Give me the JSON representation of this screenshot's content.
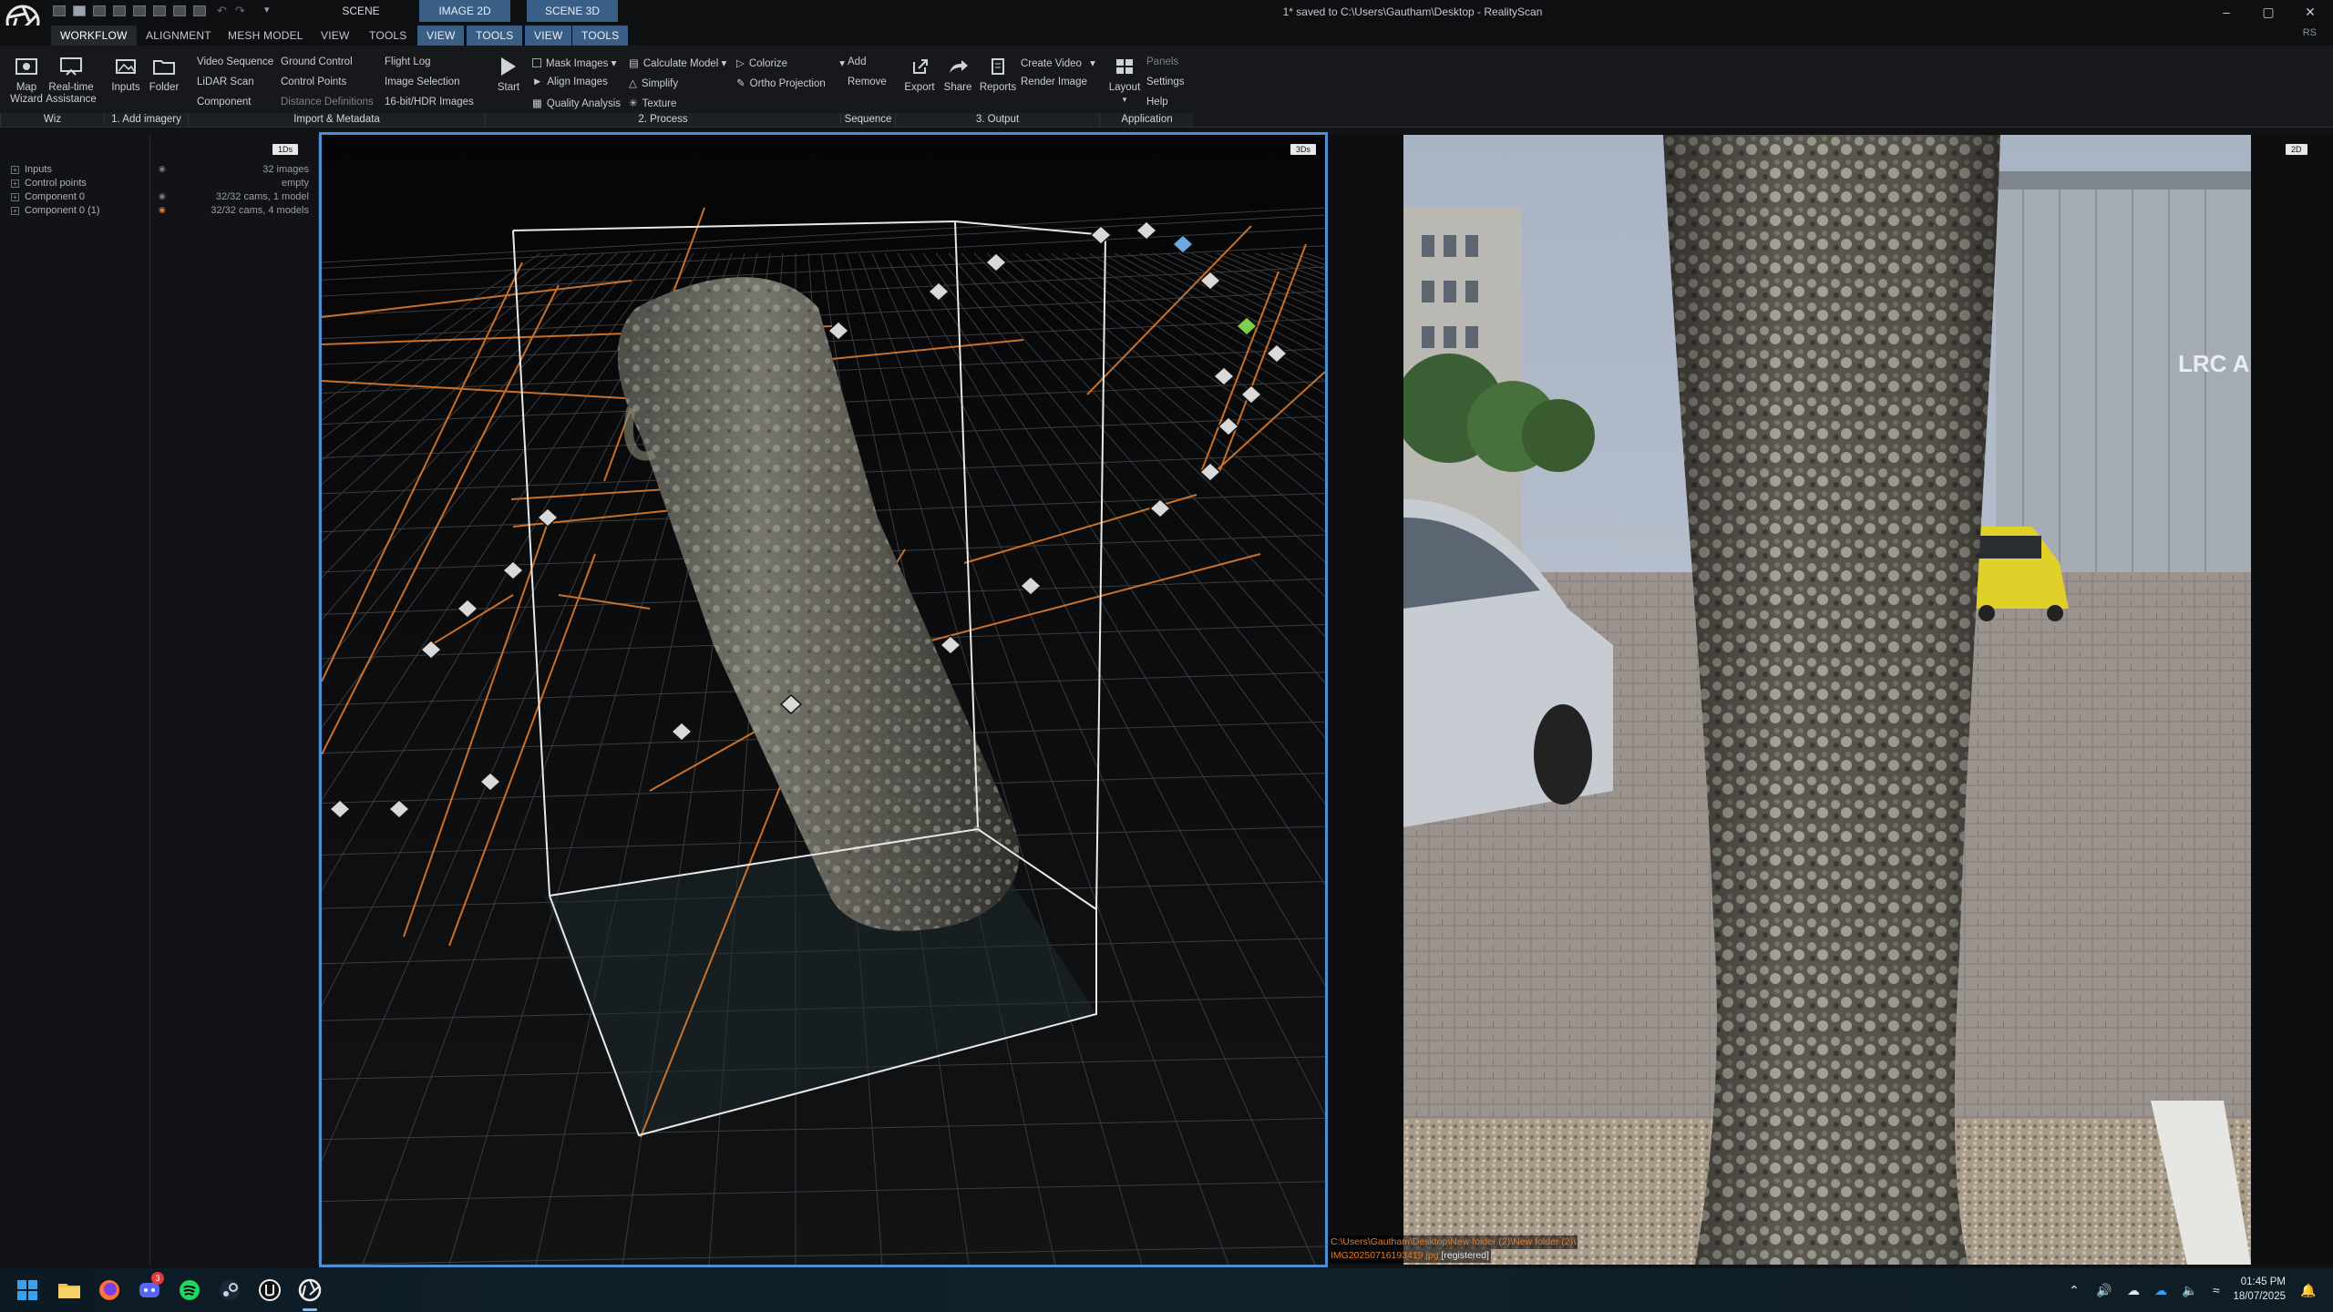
{
  "titlebar": {
    "scene_tabs": [
      "SCENE 1D",
      "IMAGE 2D",
      "SCENE 3D"
    ],
    "window_title": "1* saved to C:\\Users\\Gautham\\Desktop - RealityScan",
    "controls": [
      "–",
      "▢",
      "✕"
    ]
  },
  "ribbon_tabs": {
    "items": [
      "WORKFLOW",
      "ALIGNMENT",
      "MESH MODEL",
      "VIEW",
      "TOOLS",
      "VIEW",
      "TOOLS",
      "VIEW",
      "TOOLS"
    ],
    "badge": "RS"
  },
  "ribbon": {
    "wiz": {
      "map_wizard": [
        "Map",
        "Wizard"
      ],
      "realtime": [
        "Real-time",
        "Assistance"
      ],
      "group": "Wiz"
    },
    "add_imagery": {
      "inputs": "Inputs",
      "folder": "Folder",
      "group": "1. Add imagery"
    },
    "import": {
      "col1": [
        "Video Sequence",
        "LiDAR Scan",
        "Component"
      ],
      "col2": [
        "Ground Control",
        "Control Points",
        "Distance Definitions"
      ],
      "col3": [
        "Flight Log",
        "Image Selection",
        "16-bit/HDR Images"
      ],
      "group": "Import & Metadata"
    },
    "process": {
      "start": "Start",
      "col1": [
        "Mask Images",
        "Align Images",
        "Quality Analysis"
      ],
      "col2": [
        "Calculate Model",
        "Simplify",
        "Texture"
      ],
      "col3": [
        "Colorize",
        "Ortho Projection"
      ],
      "group": "2. Process"
    },
    "sequence": {
      "items": [
        "Add",
        "Remove"
      ],
      "group": "Sequence"
    },
    "output": {
      "export": "Export",
      "share": "Share",
      "reports": "Reports",
      "col": [
        "Create Video",
        "Render Image"
      ],
      "group": "3. Output"
    },
    "application": {
      "layout": "Layout",
      "col": [
        "Panels",
        "Settings",
        "Help"
      ],
      "group": "Application"
    }
  },
  "tree": {
    "badge": "1Ds",
    "rows": [
      {
        "label": "Inputs",
        "value": "32 images"
      },
      {
        "label": "Control points",
        "value": "empty"
      },
      {
        "label": "Component 0",
        "value": "32/32 cams, 1 model"
      },
      {
        "label": "Component 0 (1)",
        "value": "32/32 cams, 4 models"
      }
    ]
  },
  "view3d": {
    "badge": "3Ds"
  },
  "view2d": {
    "badge": "2D",
    "sign_text": "LRC A"
  },
  "status": {
    "path": "C:\\Users\\Gautham\\Desktop\\New folder (2)\\New folder (2)\\",
    "file": "IMG20250716193419.jpg",
    "state": "[registered]"
  },
  "taskbar": {
    "apps": [
      "windows-start",
      "file-explorer",
      "firefox",
      "discord",
      "spotify",
      "steam",
      "unreal-engine",
      "realityscan"
    ],
    "discord_badge": "3",
    "time": "01:45 PM",
    "date": "18/07/2025"
  },
  "colors": {
    "accent_blue": "#4a8fd8",
    "camera_ray": "#e07b2b",
    "tab_blue": "#3a5f86"
  }
}
